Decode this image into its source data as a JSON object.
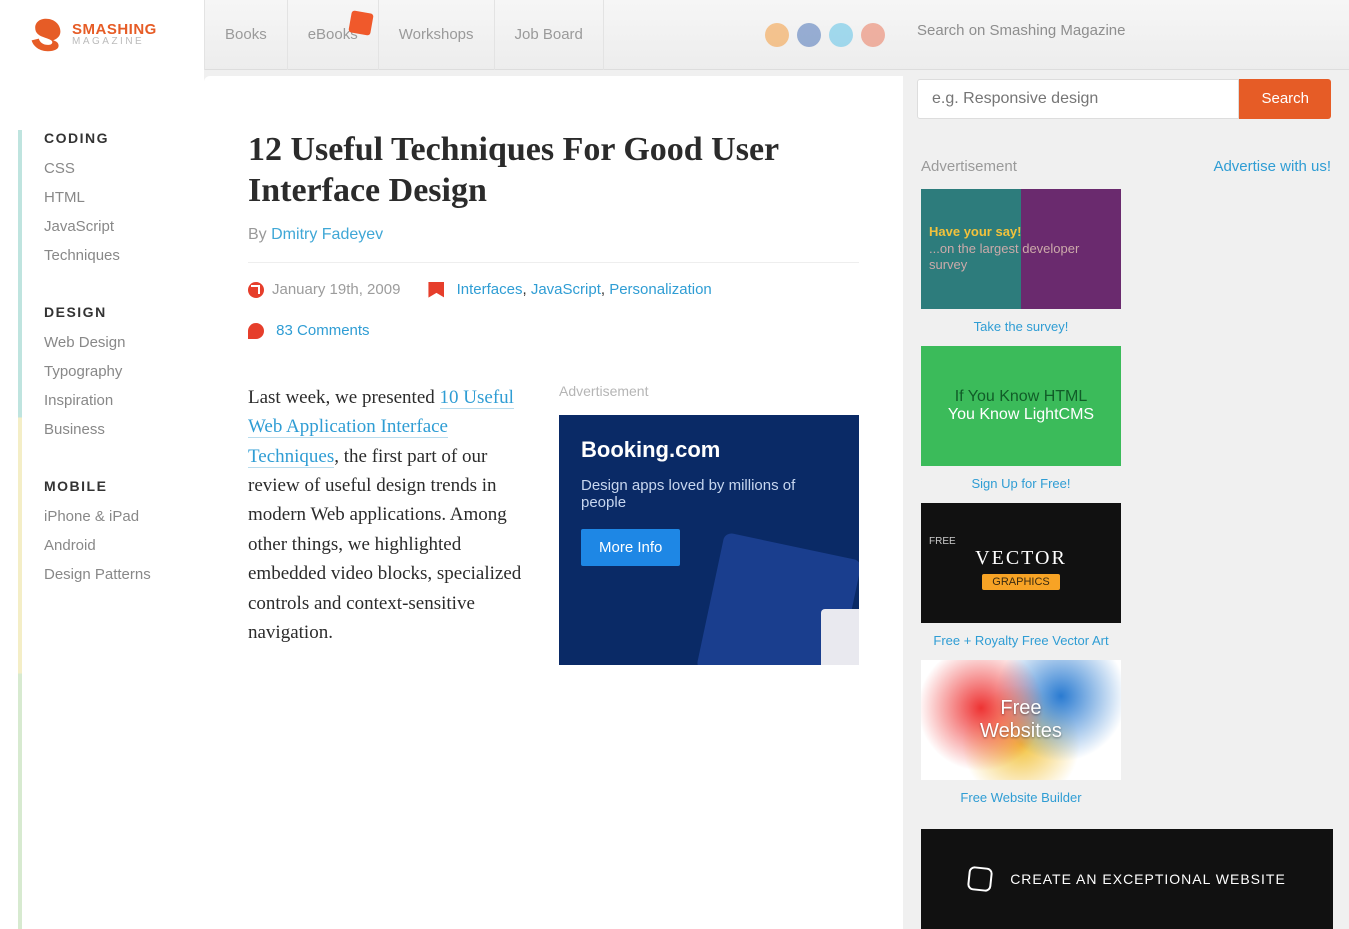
{
  "header": {
    "logo_line1": "SMASHING",
    "logo_line2": "MAGAZINE",
    "nav": [
      "Books",
      "eBooks",
      "Workshops",
      "Job Board"
    ],
    "search_label": "Search on Smashing Magazine",
    "search_placeholder": "e.g. Responsive design",
    "search_button": "Search"
  },
  "sidebar": {
    "groups": [
      {
        "title": "CODING",
        "links": [
          "CSS",
          "HTML",
          "JavaScript",
          "Techniques"
        ]
      },
      {
        "title": "DESIGN",
        "links": [
          "Web Design",
          "Typography",
          "Inspiration",
          "Business"
        ]
      },
      {
        "title": "MOBILE",
        "links": [
          "iPhone & iPad",
          "Android",
          "Design Patterns"
        ]
      }
    ]
  },
  "article": {
    "title": "12 Useful Techniques For Good User Interface Design",
    "by": "By ",
    "author": "Dmitry Fadeyev",
    "date": "January 19th, 2009",
    "tags": [
      "Interfaces",
      "JavaScript",
      "Personalization"
    ],
    "comments": "83 Comments",
    "body_pre": "Last week, we presented ",
    "body_link": "10 Useful Web Application Interface Techniques",
    "body_post": ", the first part of our review of useful design trends in modern Web applications. Among other things, we highlighted embedded video blocks, specialized controls and context-sensitive navigation.",
    "ad_label": "Advertisement",
    "booking": {
      "title": "Booking.com",
      "subtitle": "Design apps loved by millions of people",
      "cta": "More Info"
    }
  },
  "rcol": {
    "ad_label": "Advertisement",
    "ad_link": "Advertise with us!",
    "tiles": [
      {
        "caption": "Take the survey!",
        "line1": "Have your say!",
        "line2": "...on the largest developer survey"
      },
      {
        "caption": "Sign Up for Free!",
        "line1": "If You Know HTML",
        "line2": "You Know LightCMS"
      },
      {
        "caption": "Free + Royalty Free Vector Art",
        "line1": "VECTOR",
        "line2": "GRAPHICS",
        "tag": "FREE"
      },
      {
        "caption": "Free Website Builder",
        "line1": "Free",
        "line2": "Websites"
      }
    ],
    "banner": "CREATE AN EXCEPTIONAL WEBSITE"
  }
}
